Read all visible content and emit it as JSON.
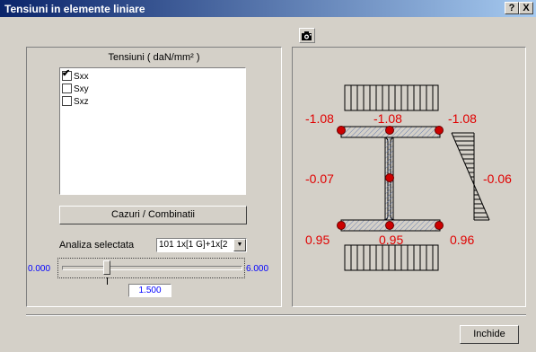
{
  "window": {
    "title": "Tensiuni in elemente liniare",
    "help_label": "?",
    "close_label": "X"
  },
  "toolbar": {
    "camera_icon": "camera-icon"
  },
  "left_panel": {
    "group_label": "Tensiuni ( daN/mm² )",
    "stress_list": [
      {
        "label": "Sxx",
        "checked": true
      },
      {
        "label": "Sxy",
        "checked": false
      },
      {
        "label": "Sxz",
        "checked": false
      }
    ],
    "cases_button_label": "Cazuri / Combinatii",
    "analysis_label": "Analiza selectata",
    "analysis_value": "101 1x[1 G]+1x[2",
    "slider_min_label": "0.000",
    "slider_max_label": "6.000",
    "slider_value": "1.500",
    "slider_fraction": 0.25
  },
  "diagram": {
    "top_left": "-1.08",
    "top_mid": "-1.08",
    "top_right": "-1.08",
    "mid_left": "-0.07",
    "mid_right": "-0.06",
    "bot_left": "0.95",
    "bot_mid": "0.95",
    "bot_right": "0.96",
    "label_color": "#e00000",
    "point_color": "#cc0000"
  },
  "footer": {
    "close_button_label": "Inchide"
  }
}
